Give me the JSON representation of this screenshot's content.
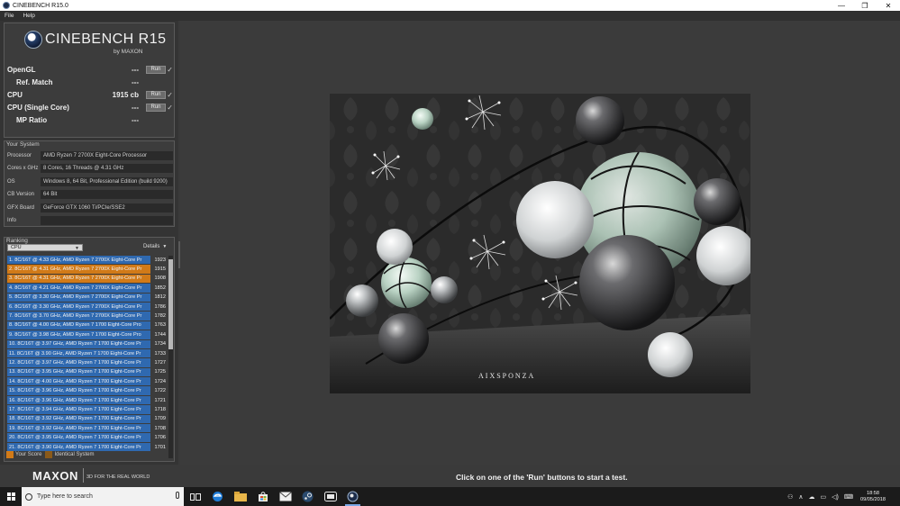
{
  "window": {
    "title": "CINEBENCH R15.0",
    "controls": [
      "—",
      "❐",
      "✕"
    ]
  },
  "menu": [
    "File",
    "Help"
  ],
  "logo": {
    "name": "CINEBENCH R15",
    "by": "by MAXON"
  },
  "benchmarks": [
    {
      "label": "OpenGL",
      "value": "---",
      "run": "Run",
      "has_run": true,
      "check": "✓",
      "indent": false
    },
    {
      "label": "Ref. Match",
      "value": "---",
      "run": "",
      "has_run": false,
      "check": "",
      "indent": true
    },
    {
      "label": "CPU",
      "value": "1915 cb",
      "run": "Run",
      "has_run": true,
      "check": "✓",
      "indent": false
    },
    {
      "label": "CPU (Single Core)",
      "value": "---",
      "run": "Run",
      "has_run": true,
      "check": "✓",
      "indent": false
    },
    {
      "label": "MP Ratio",
      "value": "---",
      "run": "",
      "has_run": false,
      "check": "",
      "indent": true
    }
  ],
  "system": {
    "title": "Your System",
    "rows": [
      {
        "key": "Processor",
        "value": "AMD Ryzen 7 2700X Eight-Core Processor"
      },
      {
        "key": "Cores x GHz",
        "value": "8 Cores, 16 Threads @ 4.31 GHz"
      },
      {
        "key": "OS",
        "value": "Windows 8, 64 Bit, Professional Edition (build 9200)"
      },
      {
        "key": "CB Version",
        "value": "64 Bit"
      },
      {
        "key": "GFX Board",
        "value": "GeForce GTX 1060 Ti/PCIe/SSE2"
      },
      {
        "key": "Info",
        "value": ""
      }
    ]
  },
  "ranking": {
    "title": "Ranking",
    "select": "CPU",
    "details": "Details",
    "items": [
      {
        "text": "1. 8C/16T @ 4.33 GHz, AMD Ryzen 7 2700X Eight-Core Pr",
        "score": "1923",
        "highlight": false
      },
      {
        "text": "2. 8C/16T @ 4.31 GHz, AMD Ryzen 7 2700X Eight-Core Pr",
        "score": "1915",
        "highlight": true
      },
      {
        "text": "3. 8C/16T @ 4.31 GHz, AMD Ryzen 7 2700X Eight-Core Pr",
        "score": "1908",
        "highlight": true
      },
      {
        "text": "4. 8C/16T @ 4.21 GHz, AMD Ryzen 7 2700X Eight-Core Pr",
        "score": "1852",
        "highlight": false
      },
      {
        "text": "5. 8C/16T @ 3.30 GHz, AMD Ryzen 7 2700X Eight-Core Pr",
        "score": "1812",
        "highlight": false
      },
      {
        "text": "6. 8C/16T @ 3.30 GHz, AMD Ryzen 7 2700X Eight-Core Pr",
        "score": "1786",
        "highlight": false
      },
      {
        "text": "7. 8C/16T @ 3.70 GHz, AMD Ryzen 7 2700X Eight-Core Pr",
        "score": "1782",
        "highlight": false
      },
      {
        "text": "8. 8C/16T @ 4.00 GHz, AMD Ryzen 7 1700 Eight-Core Pro",
        "score": "1763",
        "highlight": false
      },
      {
        "text": "9. 8C/16T @ 3.98 GHz, AMD Ryzen 7 1700 Eight-Core Pro",
        "score": "1744",
        "highlight": false
      },
      {
        "text": "10. 8C/16T @ 3.97 GHz, AMD Ryzen 7 1700 Eight-Core Pr",
        "score": "1734",
        "highlight": false
      },
      {
        "text": "11. 8C/16T @ 3.90 GHz, AMD Ryzen 7 1700 Eight-Core Pr",
        "score": "1733",
        "highlight": false
      },
      {
        "text": "12. 8C/16T @ 3.97 GHz, AMD Ryzen 7 1700 Eight-Core Pr",
        "score": "1727",
        "highlight": false
      },
      {
        "text": "13. 8C/16T @ 3.95 GHz, AMD Ryzen 7 1700 Eight-Core Pr",
        "score": "1725",
        "highlight": false
      },
      {
        "text": "14. 8C/16T @ 4.00 GHz, AMD Ryzen 7 1700 Eight-Core Pr",
        "score": "1724",
        "highlight": false
      },
      {
        "text": "15. 8C/16T @ 3.96 GHz, AMD Ryzen 7 1700 Eight-Core Pr",
        "score": "1722",
        "highlight": false
      },
      {
        "text": "16. 8C/16T @ 3.96 GHz, AMD Ryzen 7 1700 Eight-Core Pr",
        "score": "1721",
        "highlight": false
      },
      {
        "text": "17. 8C/16T @ 3.94 GHz, AMD Ryzen 7 1700 Eight-Core Pr",
        "score": "1718",
        "highlight": false
      },
      {
        "text": "18. 8C/16T @ 3.92 GHz, AMD Ryzen 7 1700 Eight-Core Pr",
        "score": "1709",
        "highlight": false
      },
      {
        "text": "19. 8C/16T @ 3.92 GHz, AMD Ryzen 7 1700 Eight-Core Pr",
        "score": "1708",
        "highlight": false
      },
      {
        "text": "20. 8C/16T @ 3.95 GHz, AMD Ryzen 7 1700 Eight-Core Pr",
        "score": "1706",
        "highlight": false
      },
      {
        "text": "21. 8C/16T @ 3.90 GHz, AMD Ryzen 7 1700 Eight-Core Pr",
        "score": "1701",
        "highlight": false
      }
    ],
    "legend": {
      "your_score": "Your Score",
      "identical": "Identical System"
    }
  },
  "footer": {
    "brand": "MAXON",
    "tagline": "3D FOR THE REAL WORLD",
    "status": "Click on one of the 'Run' buttons to start a test."
  },
  "render": {
    "watermark": "AIXSPONZA"
  },
  "taskbar": {
    "search_placeholder": "Type here to search",
    "time": "18:58",
    "date": "09/05/2018",
    "icons": [
      "task-view-icon",
      "edge-icon",
      "file-explorer-icon",
      "store-icon",
      "mail-icon",
      "steam-icon",
      "media-icon",
      "cinebench-icon"
    ]
  },
  "colors": {
    "accent_blue": "#2f69b0",
    "your_score_orange": "#d17a18",
    "identical_brown": "#8a5a1a"
  }
}
